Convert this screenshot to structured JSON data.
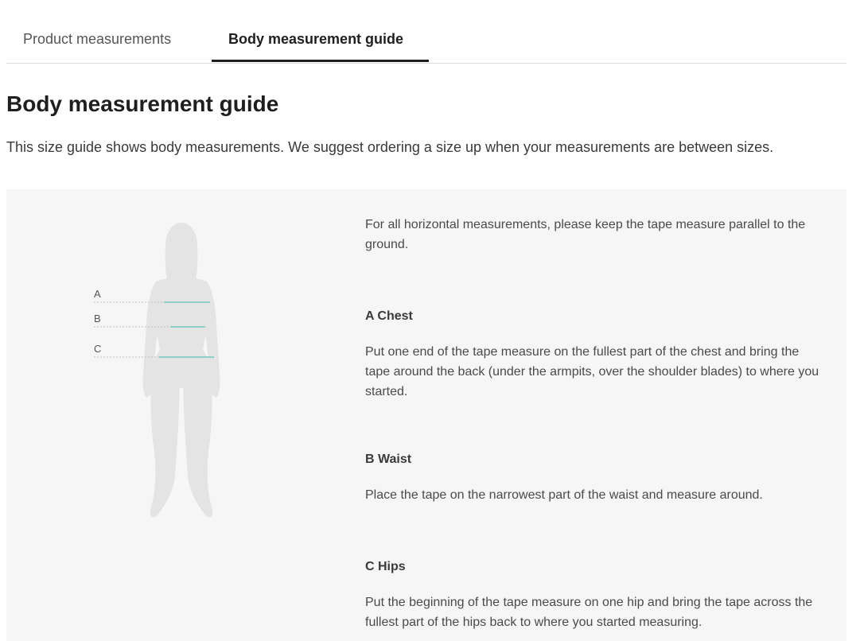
{
  "tabs": [
    {
      "label": "Product measurements"
    },
    {
      "label": "Body measurement guide"
    }
  ],
  "page_title": "Body measurement guide",
  "intro": "This size guide shows body measurements. We suggest ordering a size up when your measurements are between sizes.",
  "figure": {
    "labels": [
      "A",
      "B",
      "C"
    ],
    "line_color": "#8fcfc8",
    "body_color": "#e4e4e4"
  },
  "guide": {
    "horizontal_note": "For all horizontal measurements, please keep the tape measure parallel to the ground.",
    "sections": [
      {
        "title": "A Chest",
        "text": "Put one end of the tape measure on the fullest part of the chest and bring the tape around the back (under the armpits, over the shoulder blades) to where you started."
      },
      {
        "title": "B Waist",
        "text": "Place the tape on the narrowest part of the waist and measure around."
      },
      {
        "title": "C Hips",
        "text": "Put the beginning of the tape measure on one hip and bring the tape across the fullest part of the hips back to where you started measuring."
      }
    ]
  },
  "colors": {
    "active_tab_underline": "#1f1f1f",
    "panel_background": "#f6f6f6"
  }
}
